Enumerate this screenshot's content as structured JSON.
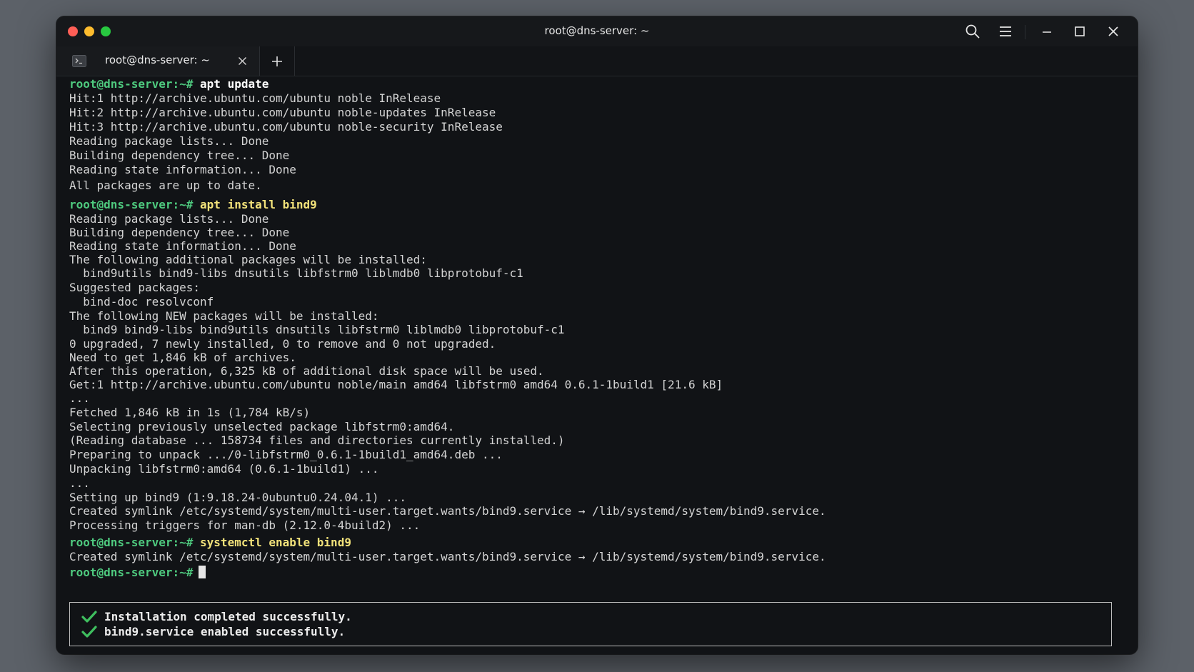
{
  "window": {
    "title": "root@dns-server: ~",
    "traffic_colors": {
      "close": "#ff5f57",
      "minimize": "#febc2e",
      "maximize": "#28c840"
    }
  },
  "titlebar_icons": [
    "search-icon",
    "menu-icon",
    "minimize-icon",
    "maximize-icon",
    "close-icon"
  ],
  "tab": {
    "label": "root@dns-server: ~",
    "icon": "terminal-icon"
  },
  "colors": {
    "prompt": "#4ec97e",
    "command_yellow": "#f2e27a",
    "output": "#d4d4d4",
    "background": "#111316"
  },
  "terminal": {
    "prompt": "root@dns-server:~#",
    "commands": [
      "apt update",
      "apt install bind9",
      "systemctl enable bind9"
    ],
    "block1": [
      "Hit:1 http://archive.ubuntu.com/ubuntu noble InRelease",
      "Hit:2 http://archive.ubuntu.com/ubuntu noble-updates InRelease",
      "Hit:3 http://archive.ubuntu.com/ubuntu noble-security InRelease",
      "Reading package lists... Done",
      "Building dependency tree... Done",
      "Reading state information... Done",
      "All packages are up to date."
    ],
    "block2": [
      "Reading package lists... Done",
      "Building dependency tree... Done",
      "Reading state information... Done",
      "The following additional packages will be installed:",
      "  bind9utils bind9-libs dnsutils libfstrm0 liblmdb0 libprotobuf-c1",
      "Suggested packages:",
      "  bind-doc resolvconf",
      "The following NEW packages will be installed:",
      "  bind9 bind9-libs bind9utils dnsutils libfstrm0 liblmdb0 libprotobuf-c1",
      "0 upgraded, 7 newly installed, 0 to remove and 0 not upgraded.",
      "Need to get 1,846 kB of archives.",
      "After this operation, 6,325 kB of additional disk space will be used.",
      "Get:1 http://archive.ubuntu.com/ubuntu noble/main amd64 libfstrm0 amd64 0.6.1-1build1 [21.6 kB]",
      "...",
      "Fetched 1,846 kB in 1s (1,784 kB/s)",
      "Selecting previously unselected package libfstrm0:amd64.",
      "(Reading database ... 158734 files and directories currently installed.)",
      "Preparing to unpack .../0-libfstrm0_0.6.1-1build1_amd64.deb ...",
      "Unpacking libfstrm0:amd64 (0.6.1-1build1) ...",
      "...",
      "Setting up bind9 (1:9.18.24-0ubuntu0.24.04.1) ...",
      "Created symlink /etc/systemd/system/multi-user.target.wants/bind9.service → /lib/systemd/system/bind9.service.",
      "Processing triggers for man-db (2.12.0-4build2) ..."
    ],
    "block3": [
      "Created symlink /etc/systemd/system/multi-user.target.wants/bind9.service → /lib/systemd/system/bind9.service."
    ]
  },
  "summary": {
    "check_color": "#3fbf5f",
    "items": [
      "Installation completed successfully.",
      "bind9.service enabled successfully."
    ]
  }
}
